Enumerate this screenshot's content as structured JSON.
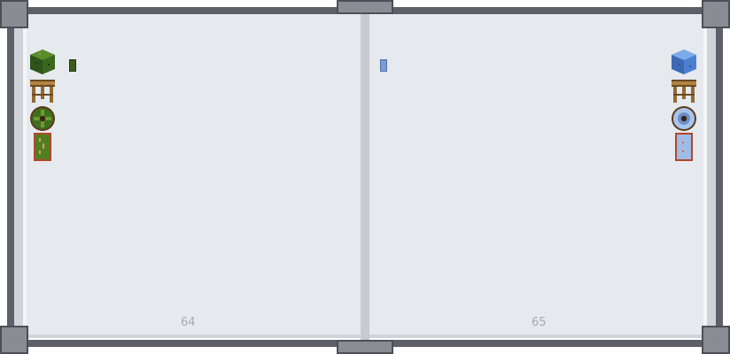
{
  "book": {
    "left_page": {
      "number": "64",
      "items": [
        {
          "name": "green-wool-block-icon",
          "color": "#3d6b1f"
        },
        {
          "name": "oak-stool-icon",
          "color": "#a67c3c"
        },
        {
          "name": "green-shield-icon",
          "color": "#4a7a24"
        },
        {
          "name": "green-banner-icon",
          "color": "#5b8a2a"
        }
      ],
      "swatch_color": "#3e5a1e"
    },
    "right_page": {
      "number": "65",
      "items": [
        {
          "name": "light-blue-wool-block-icon",
          "color": "#5b8ed8"
        },
        {
          "name": "oak-stool-icon",
          "color": "#a67c3c"
        },
        {
          "name": "light-blue-shield-icon",
          "color": "#a9c6ee"
        },
        {
          "name": "light-blue-banner-icon",
          "color": "#9fbbe6"
        }
      ],
      "swatch_color": "#7c9ad6"
    }
  }
}
